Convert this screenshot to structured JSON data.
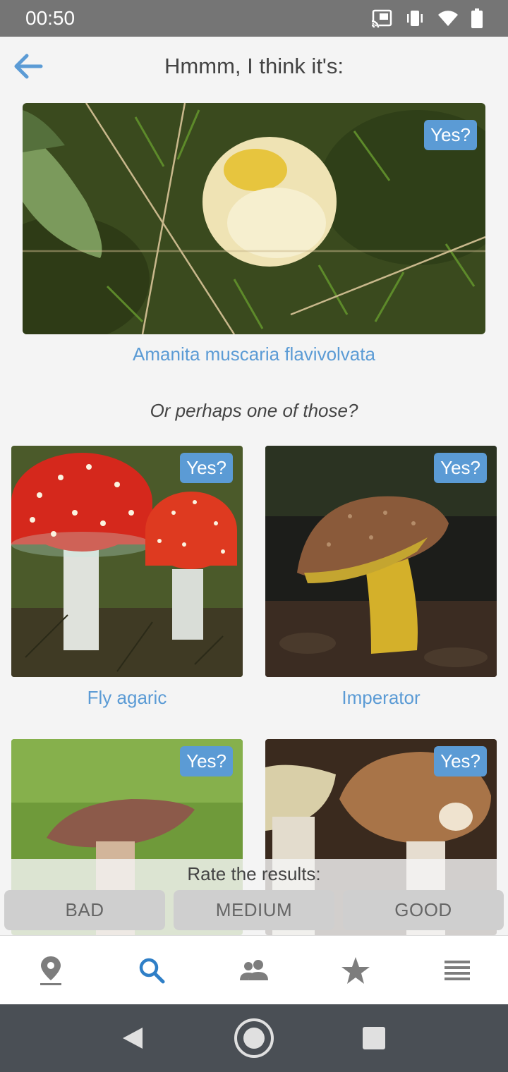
{
  "status_bar": {
    "time": "00:50"
  },
  "header": {
    "title": "Hmmm, I think it's:"
  },
  "main_result": {
    "name": "Amanita muscaria flavivolvata",
    "yes_label": "Yes?"
  },
  "alternatives_prompt": "Or perhaps one of those?",
  "alternatives": [
    {
      "name": "Fly agaric",
      "yes_label": "Yes?"
    },
    {
      "name": "Imperator",
      "yes_label": "Yes?"
    },
    {
      "name": "",
      "yes_label": "Yes?"
    },
    {
      "name": "",
      "yes_label": "Yes?"
    }
  ],
  "rating": {
    "title": "Rate the results:",
    "options": [
      "BAD",
      "MEDIUM",
      "GOOD"
    ]
  },
  "bottom_nav": {
    "items": [
      {
        "icon": "location-pin-icon",
        "active": false
      },
      {
        "icon": "search-icon",
        "active": true
      },
      {
        "icon": "people-icon",
        "active": false
      },
      {
        "icon": "star-icon",
        "active": false
      },
      {
        "icon": "menu-icon",
        "active": false
      }
    ]
  },
  "colors": {
    "accent": "#5b9bd5",
    "background": "#f4f4f4",
    "status_bar": "#757575",
    "system_nav": "#4a4f55"
  }
}
